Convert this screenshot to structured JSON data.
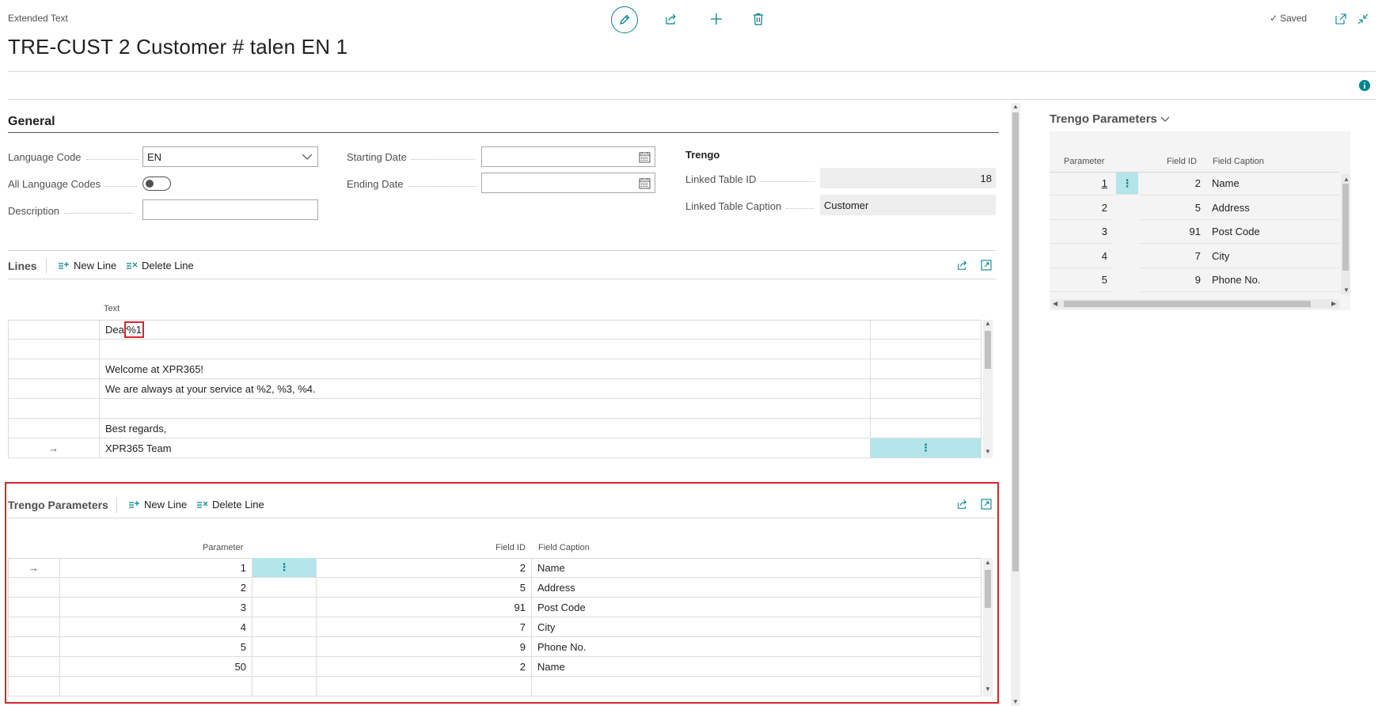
{
  "header": {
    "caption": "Extended Text",
    "title": "TRE-CUST 2 Customer # talen EN 1",
    "saved_label": "Saved"
  },
  "general": {
    "title": "General",
    "language_code_label": "Language Code",
    "language_code_value": "EN",
    "all_language_codes_label": "All Language Codes",
    "description_label": "Description",
    "description_value": "",
    "starting_date_label": "Starting Date",
    "starting_date_value": "",
    "ending_date_label": "Ending Date",
    "ending_date_value": "",
    "trengo_group_label": "Trengo",
    "linked_table_id_label": "Linked Table ID",
    "linked_table_id_value": "18",
    "linked_table_caption_label": "Linked Table Caption",
    "linked_table_caption_value": "Customer"
  },
  "lines": {
    "title": "Lines",
    "new_line_label": "New Line",
    "delete_line_label": "Delete Line",
    "column_text": "Text",
    "rows": [
      {
        "text": "Dear ",
        "highlight": "%1"
      },
      {
        "text": ""
      },
      {
        "text": "Welcome at XPR365!"
      },
      {
        "text": "We are always at your service at %2, %3, %4."
      },
      {
        "text": ""
      },
      {
        "text": "Best regards,"
      },
      {
        "text": "XPR365 Team"
      }
    ]
  },
  "trengo_parameters": {
    "title": "Trengo Parameters",
    "new_line_label": "New Line",
    "delete_line_label": "Delete Line",
    "column_parameter": "Parameter",
    "column_field_id": "Field ID",
    "column_field_caption": "Field Caption",
    "rows": [
      {
        "parameter": "1",
        "field_id": "2",
        "field_caption": "Name"
      },
      {
        "parameter": "2",
        "field_id": "5",
        "field_caption": "Address"
      },
      {
        "parameter": "3",
        "field_id": "91",
        "field_caption": "Post Code"
      },
      {
        "parameter": "4",
        "field_id": "7",
        "field_caption": "City"
      },
      {
        "parameter": "5",
        "field_id": "9",
        "field_caption": "Phone No."
      },
      {
        "parameter": "50",
        "field_id": "2",
        "field_caption": "Name"
      }
    ]
  },
  "factbox": {
    "title": "Trengo Parameters",
    "column_parameter": "Parameter",
    "column_field_id": "Field ID",
    "column_field_caption": "Field Caption",
    "rows": [
      {
        "parameter": "1",
        "field_id": "2",
        "field_caption": "Name"
      },
      {
        "parameter": "2",
        "field_id": "5",
        "field_caption": "Address"
      },
      {
        "parameter": "3",
        "field_id": "91",
        "field_caption": "Post Code"
      },
      {
        "parameter": "4",
        "field_id": "7",
        "field_caption": "City"
      },
      {
        "parameter": "5",
        "field_id": "9",
        "field_caption": "Phone No."
      }
    ]
  },
  "icons": {
    "row_arrow": "→",
    "ellipsis": "⋮",
    "saved_check": "✓"
  },
  "colors": {
    "accent": "#00848d",
    "selected_cell": "#b3e5ea",
    "highlight_box": "#d9242c"
  }
}
